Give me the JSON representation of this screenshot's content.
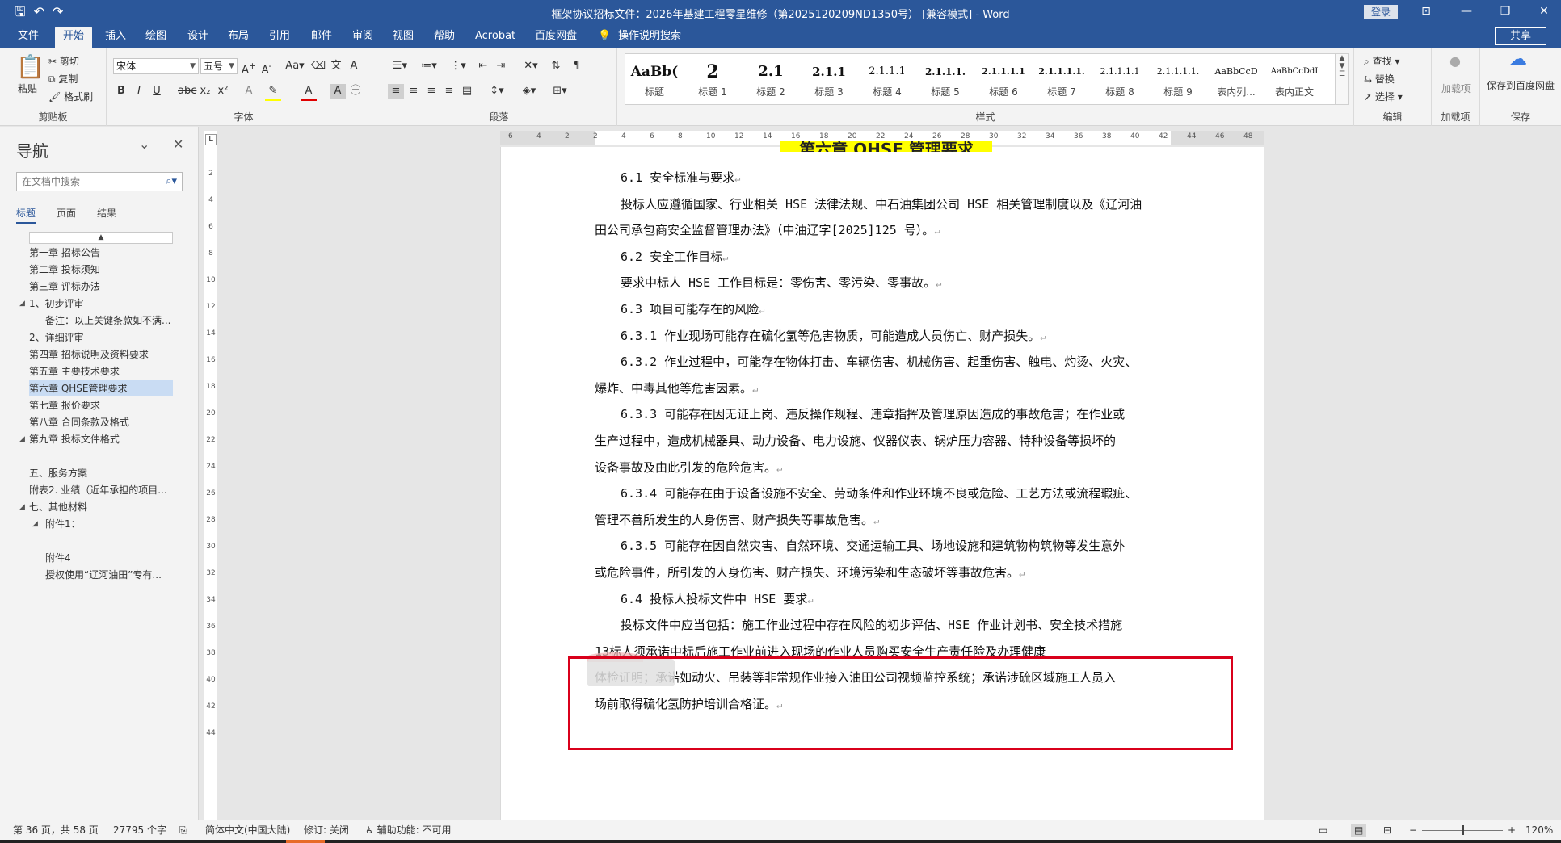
{
  "titlebar": {
    "title": "框架协议招标文件：2026年基建工程零星维修（第2025120209ND1350号） [兼容模式] - Word",
    "login": "登录",
    "qat_save": "🖫",
    "qat_undo": "↶",
    "qat_redo": "↷",
    "min": "—",
    "restore": "❐",
    "close": "✕",
    "ribbon_display": "⊡"
  },
  "tabs": [
    "文件",
    "开始",
    "插入",
    "绘图",
    "设计",
    "布局",
    "引用",
    "邮件",
    "审阅",
    "视图",
    "帮助",
    "Acrobat",
    "百度网盘",
    "操作说明搜索"
  ],
  "share": "共享",
  "ribbon": {
    "clipboard": {
      "label": "剪贴板",
      "paste": "粘贴",
      "cut": "剪切",
      "copy": "复制",
      "format_painter": "格式刷"
    },
    "font": {
      "label": "字体",
      "font_name": "宋体",
      "font_size": "五号"
    },
    "paragraph": {
      "label": "段落"
    },
    "styles": {
      "label": "样式",
      "items": [
        {
          "sample": "AaBb(",
          "name": "标题"
        },
        {
          "sample": "2",
          "name": "标题 1"
        },
        {
          "sample": "2.1",
          "name": "标题 2"
        },
        {
          "sample": "2.1.1",
          "name": "标题 3"
        },
        {
          "sample": "2.1.1.1",
          "name": "标题 4"
        },
        {
          "sample": "2.1.1.1.",
          "name": "标题 5"
        },
        {
          "sample": "2.1.1.1.1",
          "name": "标题 6"
        },
        {
          "sample": "2.1.1.1.1.",
          "name": "标题 7"
        },
        {
          "sample": "2.1.1.1.1",
          "name": "标题 8"
        },
        {
          "sample": "2.1.1.1.1.",
          "name": "标题 9"
        },
        {
          "sample": "AaBbCcD",
          "name": "表内列..."
        },
        {
          "sample": "AaBbCcDdI",
          "name": "表内正文"
        }
      ]
    },
    "editing": {
      "label": "编辑",
      "find": "查找",
      "replace": "替换",
      "select": "选择"
    },
    "addins": {
      "label": "加载项",
      "addins_btn": "加载项"
    },
    "save": {
      "label": "保存",
      "save_baidu": "保存到百度网盘"
    }
  },
  "nav": {
    "title": "导航",
    "search_placeholder": "在文档中搜索",
    "tabs": [
      "标题",
      "页面",
      "结果"
    ],
    "items": [
      {
        "text": "第一章  招标公告",
        "level": 0,
        "arrow": ""
      },
      {
        "text": "第二章  投标须知",
        "level": 0,
        "arrow": ""
      },
      {
        "text": "第三章  评标办法",
        "level": 0,
        "arrow": ""
      },
      {
        "text": "1、初步评审",
        "level": 0,
        "arrow": "◢"
      },
      {
        "text": "备注：以上关键条款如不满...",
        "level": 1,
        "arrow": ""
      },
      {
        "text": "2、详细评审",
        "level": 0,
        "arrow": ""
      },
      {
        "text": "第四章  招标说明及资料要求",
        "level": 0,
        "arrow": ""
      },
      {
        "text": "第五章  主要技术要求",
        "level": 0,
        "arrow": ""
      },
      {
        "text": "第六章  QHSE管理要求",
        "level": 0,
        "arrow": "",
        "selected": true
      },
      {
        "text": "第七章  报价要求",
        "level": 0,
        "arrow": ""
      },
      {
        "text": "第八章  合同条款及格式",
        "level": 0,
        "arrow": ""
      },
      {
        "text": "第九章  投标文件格式",
        "level": 0,
        "arrow": "◢"
      },
      {
        "text": "",
        "level": 0,
        "arrow": ""
      },
      {
        "text": "五、服务方案",
        "level": 0,
        "arrow": ""
      },
      {
        "text": "附表2. 业绩（近年承担的项目...",
        "level": 0,
        "arrow": ""
      },
      {
        "text": "七、其他材料",
        "level": 0,
        "arrow": "◢"
      },
      {
        "text": "附件1：",
        "level": 1,
        "arrow": "◢"
      },
      {
        "text": "",
        "level": 0,
        "arrow": ""
      },
      {
        "text": "附件4",
        "level": 1,
        "arrow": ""
      },
      {
        "text": "授权使用“辽河油田”专有...",
        "level": 1,
        "arrow": ""
      }
    ]
  },
  "ruler": {
    "h_ticks": [
      "6",
      "4",
      "2",
      "2",
      "4",
      "6",
      "8",
      "10",
      "12",
      "14",
      "16",
      "18",
      "20",
      "22",
      "24",
      "26",
      "28",
      "30",
      "32",
      "34",
      "36",
      "38",
      "40",
      "42",
      "44",
      "46",
      "48"
    ],
    "v_ticks": [
      "2",
      "4",
      "6",
      "8",
      "10",
      "12",
      "14",
      "16",
      "18",
      "20",
      "22",
      "24",
      "26",
      "28",
      "30",
      "32",
      "34",
      "36",
      "38",
      "40",
      "42",
      "44"
    ],
    "corner": "L"
  },
  "document": {
    "chapter_heading": "第六章  QHSE 管理要求",
    "lines": [
      {
        "text": "6.1 安全标准与要求",
        "indent": true
      },
      {
        "text": "投标人应遵循国家、行业相关 HSE 法律法规、中石油集团公司 HSE 相关管理制度以及《辽河油",
        "indent": true
      },
      {
        "text": "田公司承包商安全监督管理办法》（中油辽字[2025]125 号）。",
        "indent": false
      },
      {
        "text": "6.2 安全工作目标",
        "indent": true
      },
      {
        "text": "要求中标人 HSE 工作目标是：零伤害、零污染、零事故。",
        "indent": true
      },
      {
        "text": "6.3 项目可能存在的风险",
        "indent": true
      },
      {
        "text": "6.3.1 作业现场可能存在硫化氢等危害物质，可能造成人员伤亡、财产损失。",
        "indent": true
      },
      {
        "text": "6.3.2 作业过程中，可能存在物体打击、车辆伤害、机械伤害、起重伤害、触电、灼烫、火灾、",
        "indent": true
      },
      {
        "text": "爆炸、中毒其他等危害因素。",
        "indent": false
      },
      {
        "text": "6.3.3 可能存在因无证上岗、违反操作规程、违章指挥及管理原因造成的事故危害；在作业或",
        "indent": true
      },
      {
        "text": "生产过程中，造成机械器具、动力设备、电力设施、仪器仪表、锅炉压力容器、特种设备等损坏的",
        "indent": false
      },
      {
        "text": "设备事故及由此引发的危险危害。",
        "indent": false
      },
      {
        "text": "6.3.4 可能存在由于设备设施不安全、劳动条件和作业环境不良或危险、工艺方法或流程瑕疵、",
        "indent": true
      },
      {
        "text": "管理不善所发生的人身伤害、财产损失等事故危害。",
        "indent": false
      },
      {
        "text": "6.3.5 可能存在因自然灾害、自然环境、交通运输工具、场地设施和建筑物构筑物等发生意外",
        "indent": true
      },
      {
        "text": "或危险事件，所引发的人身伤害、财产损失、环境污染和生态破坏等事故危害。",
        "indent": false
      },
      {
        "text": "6.4 投标人投标文件中 HSE 要求",
        "indent": true
      },
      {
        "text": "投标文件中应当包括：施工作业过程中存在风险的初步评估、HSE 作业计划书、安全技术措施",
        "indent": true
      },
      {
        "text": "          13标人须承诺中标后施工作业前进入现场的作业人员购买安全生产责任险及办理健康",
        "indent": false
      },
      {
        "text": "体检证明；承诺如动火、吊装等非常规作业接入油田公司视频监控系统；承诺涉硫区域施工人员入",
        "indent": false
      },
      {
        "text": "场前取得硫化氢防护培训合格证。",
        "indent": false
      }
    ],
    "paragraph_mark": "↵"
  },
  "status": {
    "page": "第 36 页，共 58 页",
    "words": "27795 个字",
    "language": "简体中文(中国大陆)",
    "track": "修订: 关闭",
    "accessibility": "辅助功能: 不可用",
    "zoom": "120%",
    "zoom_minus": "−",
    "zoom_plus": "+"
  }
}
